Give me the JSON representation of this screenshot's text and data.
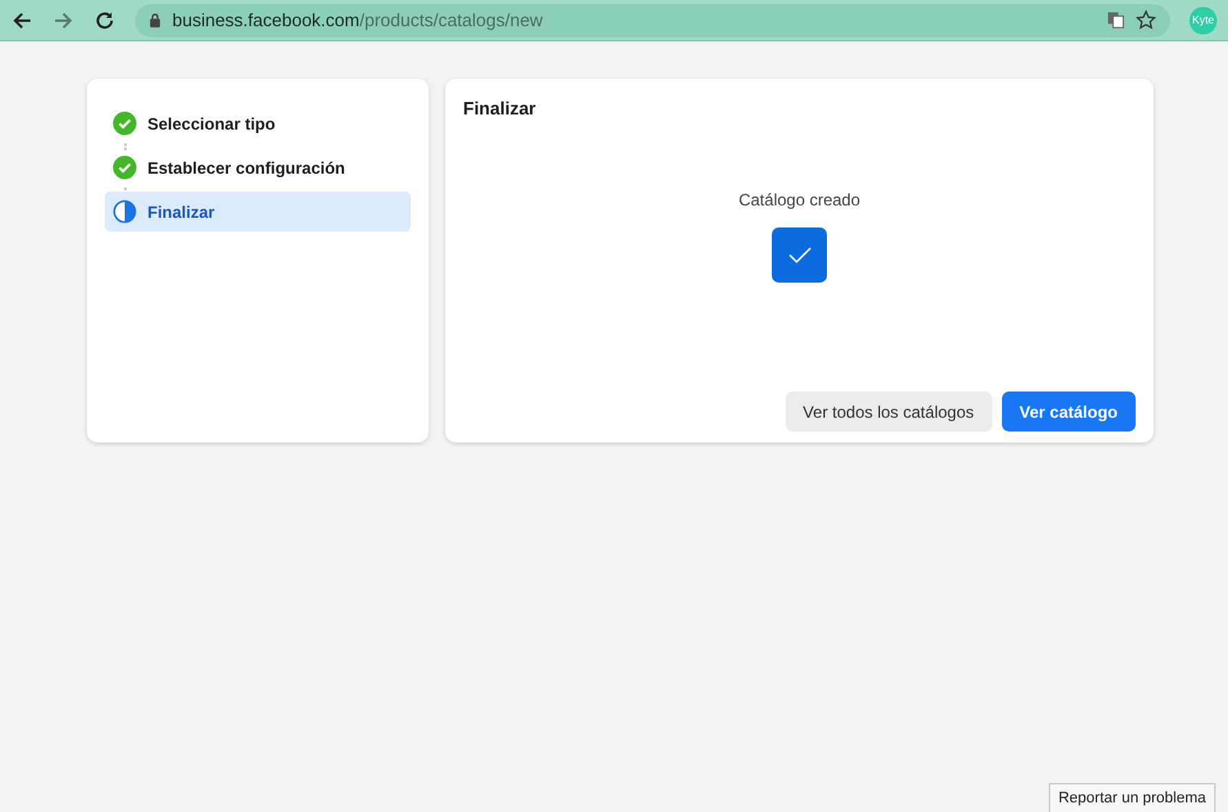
{
  "browser": {
    "url_host": "business.facebook.com",
    "url_path": "/products/catalogs/new",
    "profile": "Kyte"
  },
  "steps": [
    {
      "label": "Seleccionar tipo",
      "kind": "done",
      "selected": false
    },
    {
      "label": "Establecer configuración",
      "kind": "done",
      "selected": false
    },
    {
      "label": "Finalizar",
      "kind": "current",
      "selected": true
    }
  ],
  "panel": {
    "title": "Finalizar",
    "message": "Catálogo creado",
    "buttons": [
      {
        "label": "Ver todos los catálogos",
        "kind": "secondary"
      },
      {
        "label": "Ver catálogo",
        "kind": "primary"
      }
    ]
  },
  "report_button": "Reportar un problema"
}
